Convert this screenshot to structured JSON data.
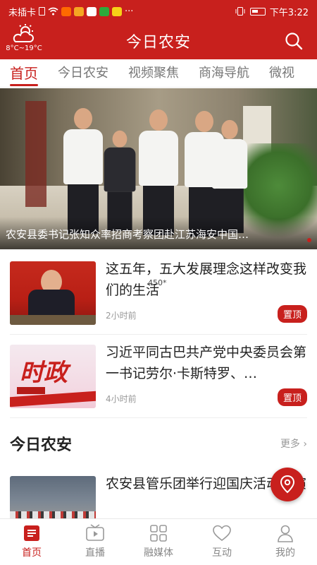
{
  "status": {
    "left_text": "未插卡",
    "time": "下午3:22",
    "dots": "···"
  },
  "header": {
    "title": "今日农安",
    "temperature": "8°C~19°C"
  },
  "tabs": [
    {
      "label": "首页",
      "active": true
    },
    {
      "label": "今日农安",
      "active": false
    },
    {
      "label": "视频聚焦",
      "active": false
    },
    {
      "label": "商海导航",
      "active": false
    },
    {
      "label": "微视",
      "active": false
    }
  ],
  "hero": {
    "caption": "农安县委书记张知众率招商考察团赴江苏海安中国…"
  },
  "news": [
    {
      "title": "这五年，五大发展理念这样改变我们的生活",
      "time": "2小时前",
      "badge": "置顶",
      "overlay": "450*"
    },
    {
      "title": "习近平同古巴共产党中央委员会第一书记劳尔·卡斯特罗、…",
      "time": "4小时前",
      "badge": "置顶",
      "thumb_text": "时政"
    }
  ],
  "section": {
    "title": "今日农安",
    "more": "更多"
  },
  "news3": {
    "title": "农安县管乐团举行迎国庆活动义演"
  },
  "bottom_nav": [
    {
      "label": "首页",
      "icon": "home-icon",
      "active": true
    },
    {
      "label": "直播",
      "icon": "live-icon",
      "active": false
    },
    {
      "label": "融媒体",
      "icon": "grid-icon",
      "active": false
    },
    {
      "label": "互动",
      "icon": "heart-icon",
      "active": false
    },
    {
      "label": "我的",
      "icon": "user-icon",
      "active": false
    }
  ],
  "colors": {
    "brand": "#c8201d"
  }
}
